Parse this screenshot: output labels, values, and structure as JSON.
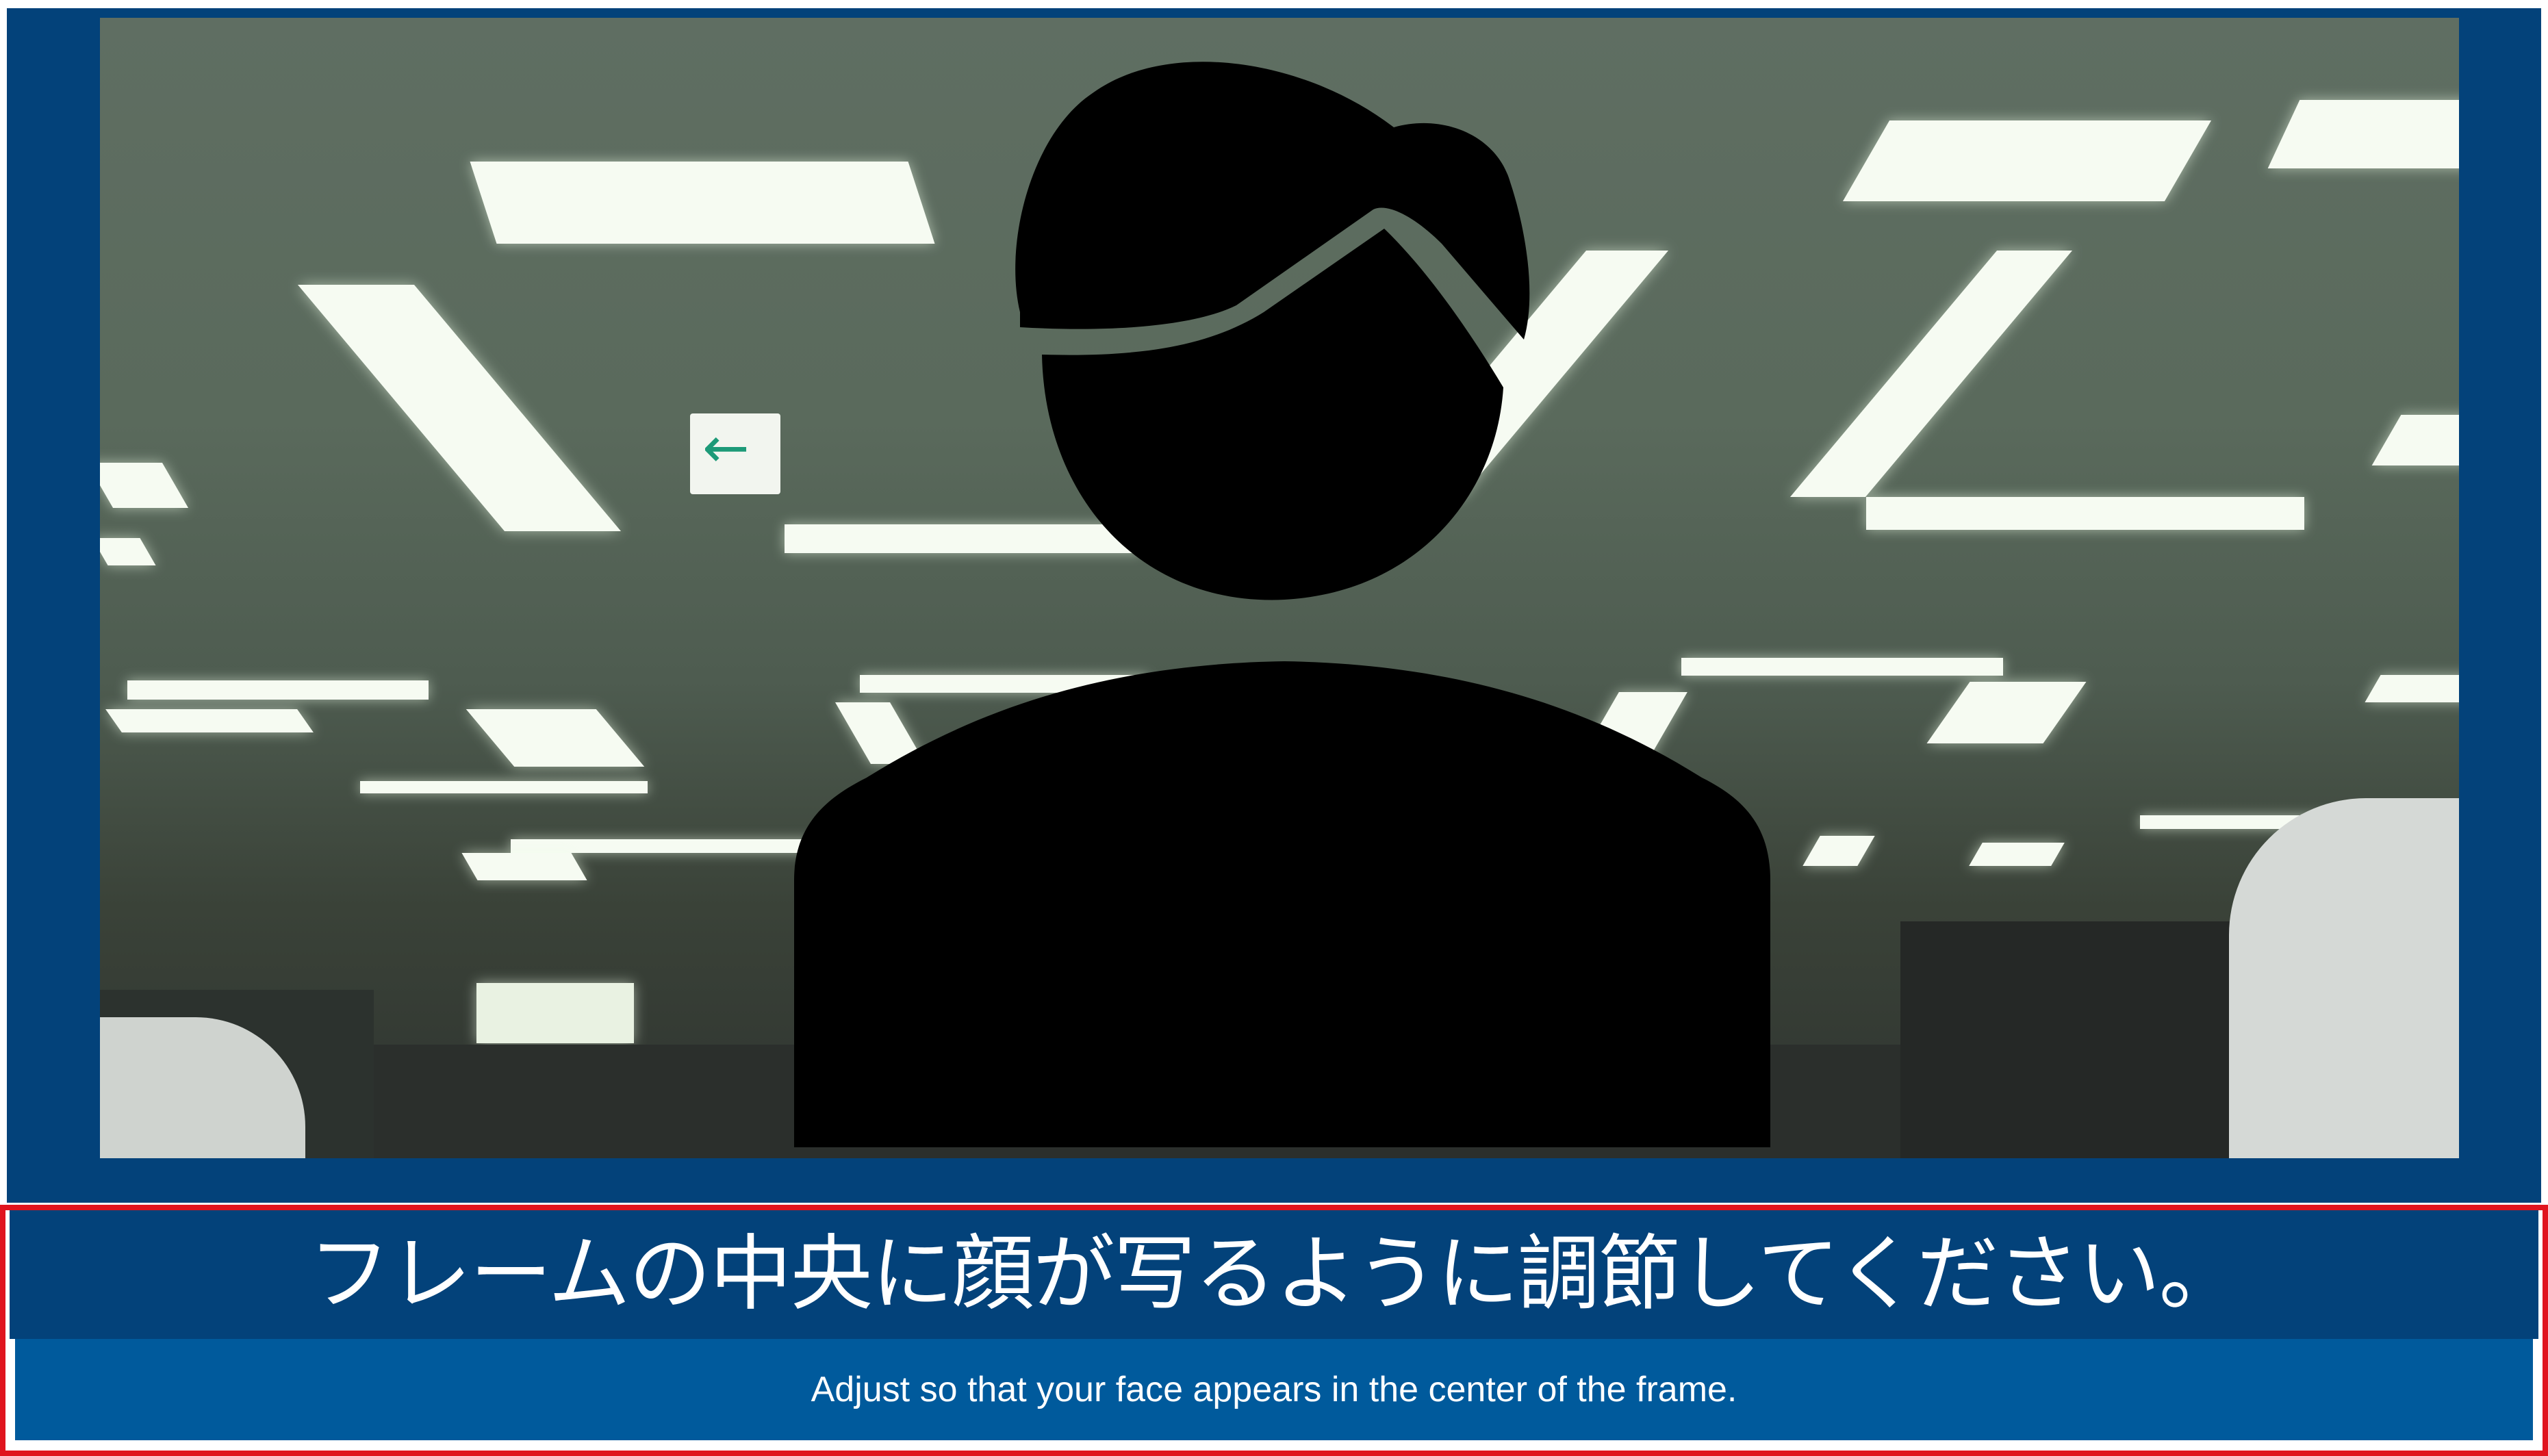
{
  "camera_view": {
    "exit_sign_glyph": "←",
    "silhouette_icon": "person-silhouette-icon"
  },
  "instructions": {
    "japanese": "フレームの中央に顔が写るように調節してください。",
    "english": "Adjust so that your face appears in the center of the frame."
  },
  "colors": {
    "panel_blue": "#03427a",
    "subtitle_blue": "#005a9c",
    "highlight_border": "#e0141e",
    "silhouette": "#000000"
  }
}
